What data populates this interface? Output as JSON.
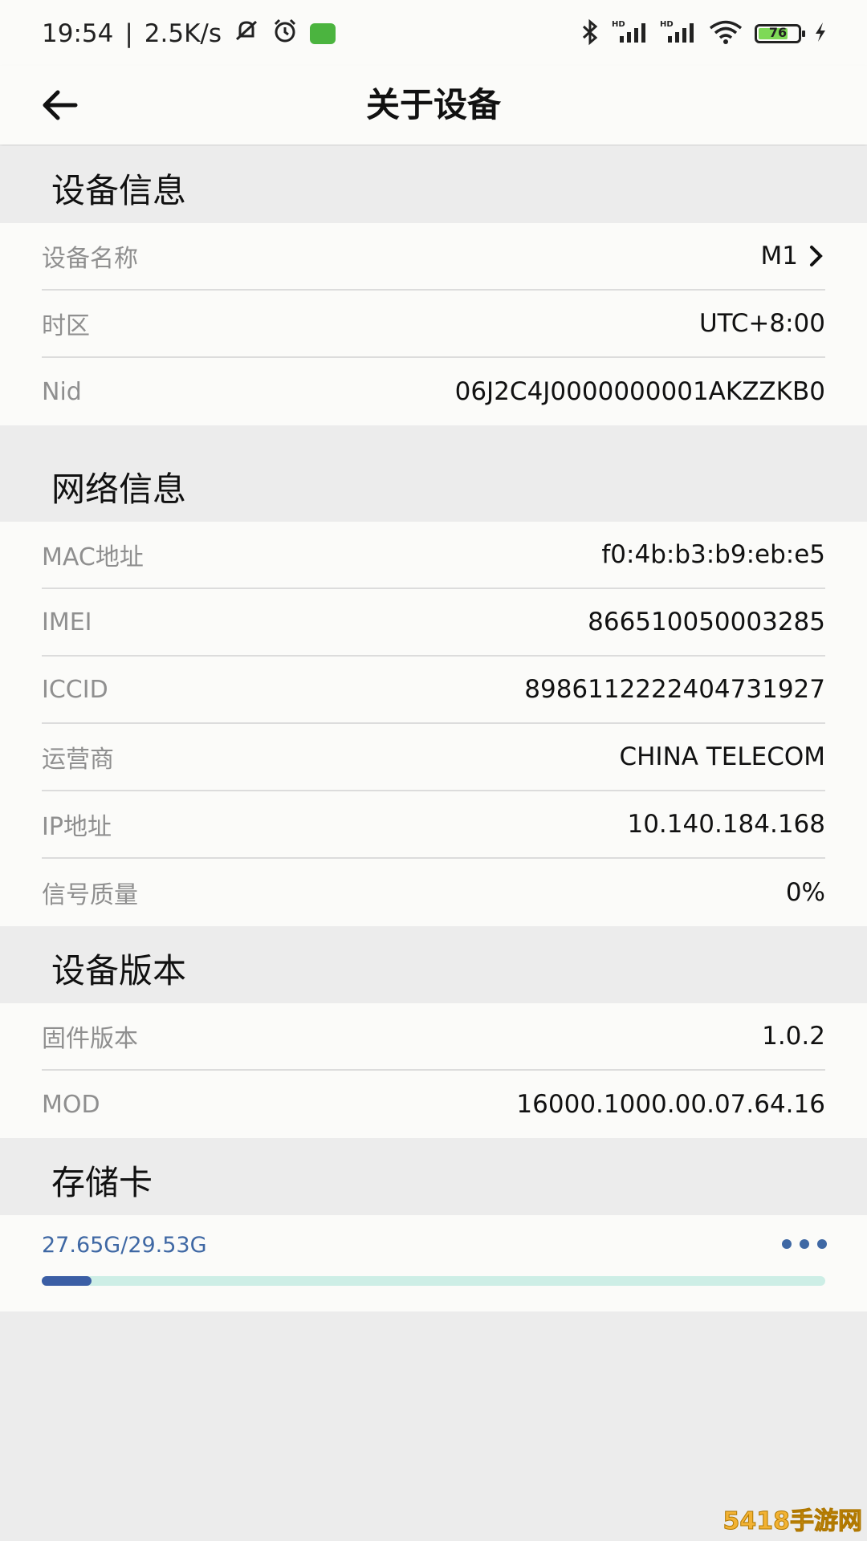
{
  "status_bar": {
    "time": "19:54",
    "separator": "|",
    "net_speed": "2.5K/s",
    "battery_level": "76",
    "battery_fraction": 0.76,
    "hd1": "HD",
    "hd2": "HD"
  },
  "header": {
    "title": "关于设备"
  },
  "sections": {
    "device_info": {
      "title": "设备信息",
      "rows": [
        {
          "label": "设备名称",
          "value": "M1"
        },
        {
          "label": "时区",
          "value": "UTC+8:00"
        },
        {
          "label": "Nid",
          "value": "06J2C4J0000000001AKZZKB0"
        }
      ]
    },
    "network_info": {
      "title": "网络信息",
      "rows": [
        {
          "label": "MAC地址",
          "value": "f0:4b:b3:b9:eb:e5"
        },
        {
          "label": "IMEI",
          "value": "866510050003285"
        },
        {
          "label": "ICCID",
          "value": "89861122224047319​27"
        },
        {
          "label": "运营商",
          "value": "CHINA TELECOM"
        },
        {
          "label": "IP地址",
          "value": "10.140.184.168"
        },
        {
          "label": "信号质量",
          "value": "0%"
        }
      ]
    },
    "device_version": {
      "title": "设备版本",
      "rows": [
        {
          "label": "固件版本",
          "value": "1.0.2"
        },
        {
          "label": "MOD",
          "value": "16000.1000.00.07.64.16"
        }
      ]
    },
    "storage": {
      "title": "存储卡",
      "usage_text": "27.65G/29.53G",
      "usage_fraction": 0.064
    }
  },
  "colors": {
    "accent": "#3f68a4",
    "progress_track": "#cdeee6",
    "page_bg": "#ececec",
    "card_bg": "#fbfbf9"
  },
  "watermark": "5418手游网"
}
